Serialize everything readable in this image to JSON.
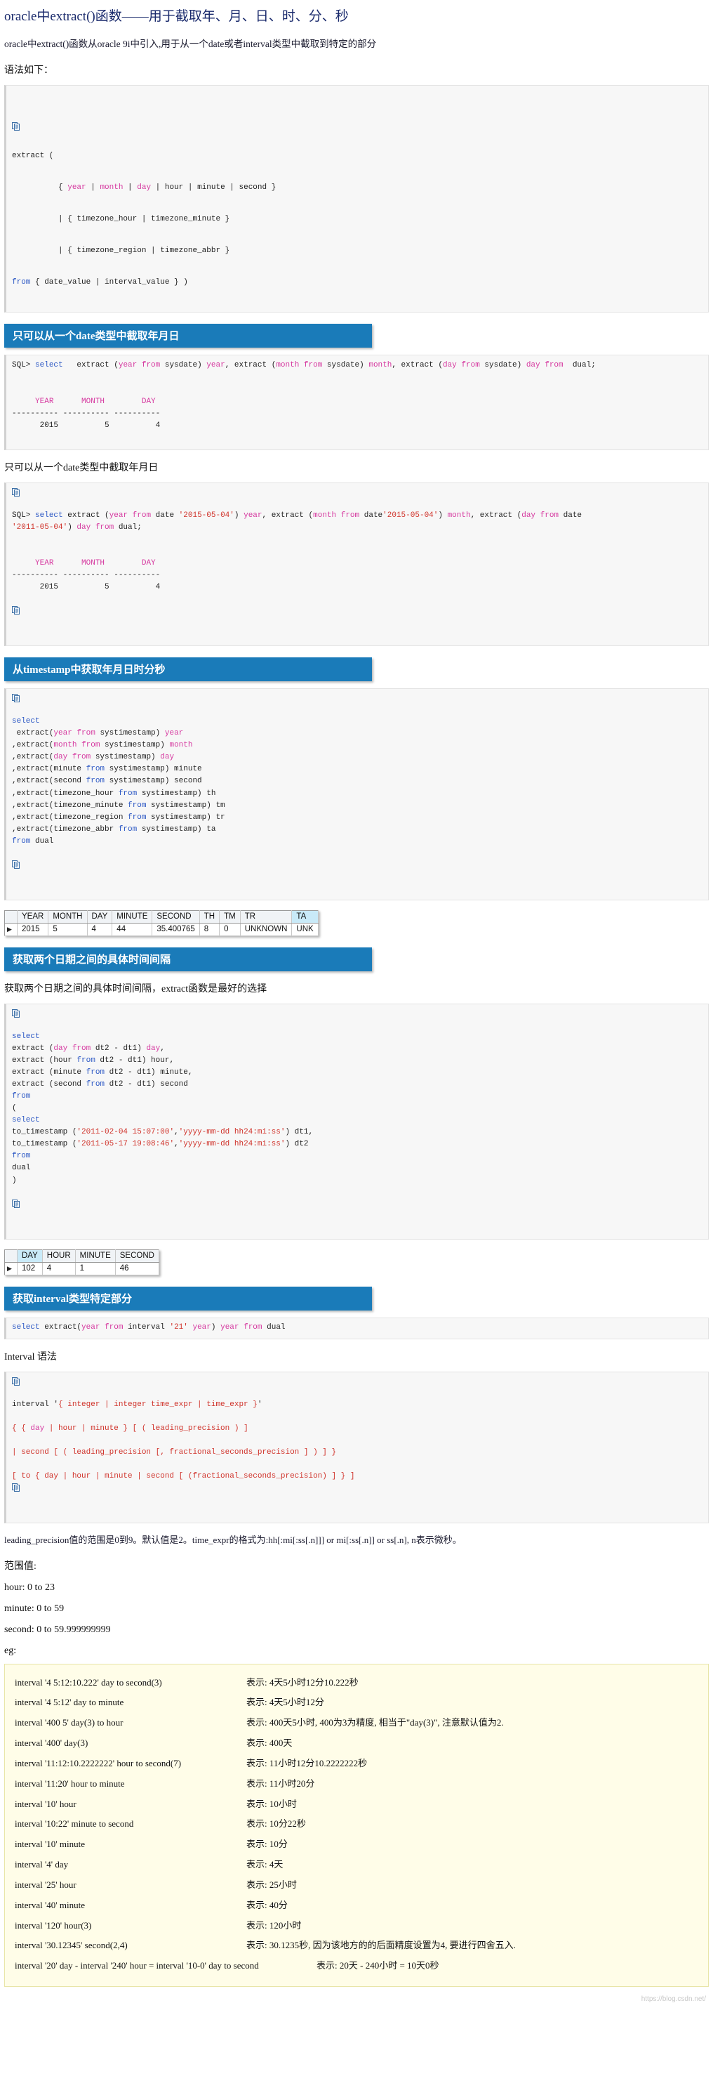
{
  "title": "oracle中extract()函数——用于截取年、月、日、时、分、秒",
  "intro": "oracle中extract()函数从oracle 9i中引入,用于从一个date或者interval类型中截取到特定的部分",
  "syntax_label": "语法如下：",
  "icons": {
    "copy": "copy-icon"
  },
  "syntax_block": {
    "lines": [
      "extract (",
      "",
      "        { year | month | day | hour | minute | second }",
      "",
      "        | { timezone_hour | timezone_minute }",
      "",
      "        | { timezone_region | timezone_abbr }",
      "",
      "from { date_value | interval_value } )"
    ]
  },
  "sections": [
    {
      "heading": "只可以从一个date类型中截取年月日",
      "code": "SQL> select   extract (year from sysdate) year, extract (month from sysdate) month, extract (day from sysdate) day from  dual;\n\n     YEAR      MONTH        DAY\n---------- ---------- ----------\n      2015          5          4",
      "note": "只可以从一个date类型中截取年月日"
    },
    {
      "heading": "从timestamp中获取年月日时分秒",
      "code": "select\n extract(year from systimestamp) year\n,extract(month from systimestamp) month\n,extract(day from systimestamp) day\n,extract(minute from systimestamp) minute\n,extract(second from systimestamp) second\n,extract(timezone_hour from systimestamp) th\n,extract(timezone_minute from systimestamp) tm\n,extract(timezone_region from systimestamp) tr\n,extract(timezone_abbr from systimestamp) ta\nfrom dual"
    },
    {
      "heading": "获取两个日期之间的具体时间间隔",
      "note": "获取两个日期之间的具体时间间隔，extract函数是最好的选择"
    },
    {
      "heading": "获取interval类型特定部分",
      "code": "select extract(year from interval '21' year) year from dual"
    }
  ],
  "sql_date_block": {
    "line1": "SQL> select extract (year from date '2015-05-04') year, extract (month from date'2015-05-04') month, extract (day from date",
    "line2": "'2011-05-04') day from dual;",
    "result_header": "     YEAR      MONTH        DAY",
    "result_rule": "---------- ---------- ----------",
    "result_row": "      2015          5          4"
  },
  "timestamp_grid": {
    "columns": [
      "YEAR",
      "MONTH",
      "DAY",
      "MINUTE",
      "SECOND",
      "TH",
      "TM",
      "TR",
      "TA"
    ],
    "selected_column": "TA",
    "rows": [
      [
        "2015",
        "5",
        "4",
        "44",
        "35.400765",
        "8",
        "0",
        "UNKNOWN",
        "UNK"
      ]
    ]
  },
  "interval_diff_code": "select\nextract (day from dt2 - dt1) day,\nextract (hour from dt2 - dt1) hour,\nextract (minute from dt2 - dt1) minute,\nextract (second from dt2 - dt1) second\nfrom\n(\nselect\nto_timestamp ('2011-02-04 15:07:00','yyyy-mm-dd hh24:mi:ss') dt1,\nto_timestamp ('2011-05-17 19:08:46','yyyy-mm-dd hh24:mi:ss') dt2\nfrom\ndual\n)",
  "diff_grid": {
    "columns": [
      "DAY",
      "HOUR",
      "MINUTE",
      "SECOND"
    ],
    "selected_column": "DAY",
    "rows": [
      [
        "102",
        "4",
        "1",
        "46"
      ]
    ]
  },
  "interval_syntax": {
    "label": "Interval 语法",
    "lines": [
      "interval '{ integer | integer time_expr | time_expr }'",
      "",
      "{ { day | hour | minute } [ ( leading_precision ) ]",
      "",
      "| second [ ( leading_precision [, fractional_seconds_precision ] ) ] }",
      "",
      "[ to { day | hour | minute | second [ (fractional_seconds_precision) ] } ]"
    ]
  },
  "precision_note": "leading_precision值的范围是0到9。默认值是2。time_expr的格式为:hh[:mi[:ss[.n]]] or mi[:ss[.n]] or ss[.n], n表示微秒。",
  "range_label": "范围值:",
  "ranges": [
    "hour: 0 to 23",
    "minute: 0 to 59",
    "second: 0 to 59.999999999"
  ],
  "eg_label": "eg:",
  "examples": [
    {
      "code": "interval '4 5:12:10.222' day to second(3)",
      "desc": "表示: 4天5小时12分10.222秒"
    },
    {
      "code": "interval '4 5:12' day to minute",
      "desc": "表示: 4天5小时12分"
    },
    {
      "code": "interval '400 5' day(3) to hour",
      "desc": "表示: 400天5小时, 400为3为精度, 相当于\"day(3)\", 注意默认值为2."
    },
    {
      "code": "interval '400' day(3)",
      "desc": "表示: 400天"
    },
    {
      "code": "interval '11:12:10.2222222' hour to second(7)",
      "desc": "表示: 11小时12分10.2222222秒"
    },
    {
      "code": "interval '11:20' hour to minute",
      "desc": "表示: 11小时20分"
    },
    {
      "code": "interval '10' hour",
      "desc": "表示: 10小时"
    },
    {
      "code": "interval '10:22' minute to second",
      "desc": "表示: 10分22秒"
    },
    {
      "code": "interval '10' minute",
      "desc": "表示: 10分"
    },
    {
      "code": "interval '4' day",
      "desc": "表示: 4天"
    },
    {
      "code": "interval '25' hour",
      "desc": "表示: 25小时"
    },
    {
      "code": "interval '40' minute",
      "desc": "表示: 40分"
    },
    {
      "code": "interval '120' hour(3)",
      "desc": "表示: 120小时"
    },
    {
      "code": "interval '30.12345' second(2,4)",
      "desc": "表示: 30.1235秒, 因为该地方的的后面精度设置为4, 要进行四舍五入."
    },
    {
      "code": "interval '20' day - interval '240' hour = interval '10-0' day to second",
      "desc": "表示: 20天 - 240小时 = 10天0秒"
    }
  ],
  "colors": {
    "accent_blue": "#1a7bb9",
    "title_blue": "#1a2a6c",
    "keyword": "#2b57c4",
    "alias": "#d63aa0",
    "string": "#d0342c",
    "yellow_bg": "#fffde8"
  }
}
